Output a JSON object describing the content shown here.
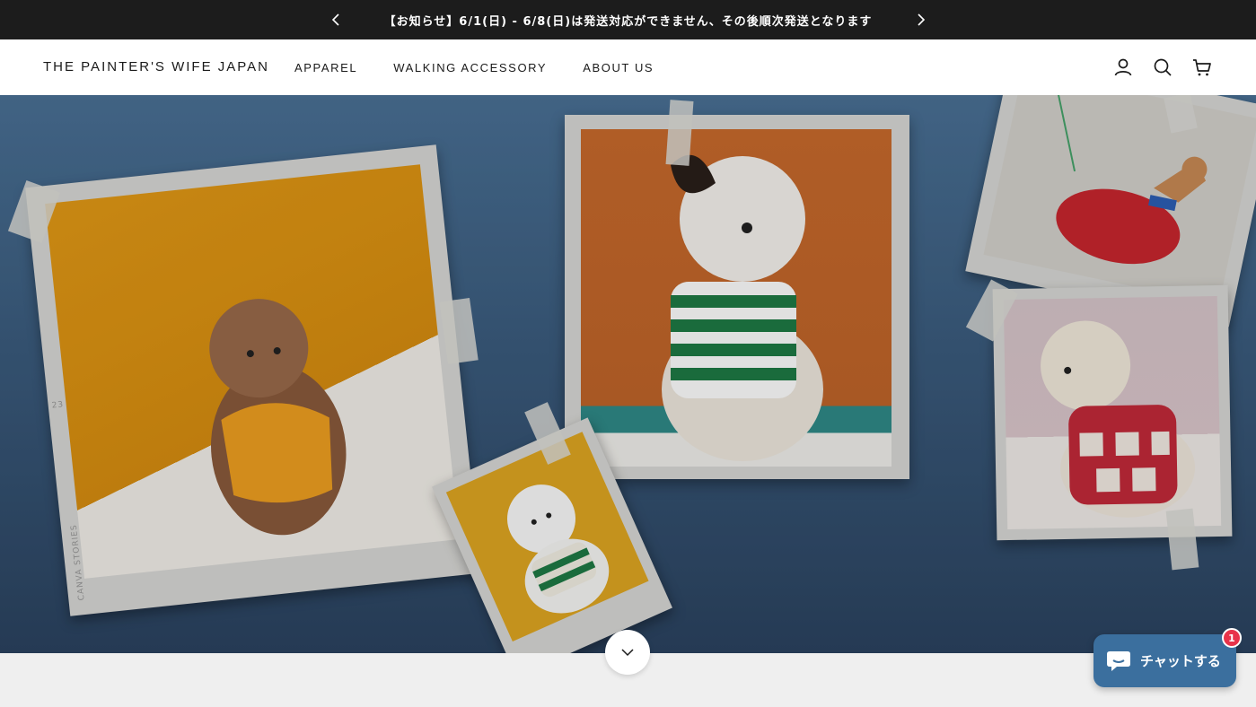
{
  "announcement": {
    "text": "【お知らせ】6/1(日) - 6/8(日)は発送対応ができません、その後順次発送となります",
    "prev_icon": "chevron-left-icon",
    "next_icon": "chevron-right-icon"
  },
  "header": {
    "logo": "THE PAINTER'S WIFE JAPAN",
    "nav": [
      "APPAREL",
      "WALKING ACCESSORY",
      "ABOUT US"
    ],
    "icons": [
      "account-icon",
      "search-icon",
      "cart-icon"
    ]
  },
  "hero": {
    "photo_stamp": "CANVA STORIES",
    "photo_number": "23"
  },
  "scroll_button": {
    "icon": "chevron-down-icon"
  },
  "chat": {
    "label": "チャットする",
    "badge": "1",
    "accent": "#3b6f9e",
    "badge_color": "#e8334a"
  }
}
